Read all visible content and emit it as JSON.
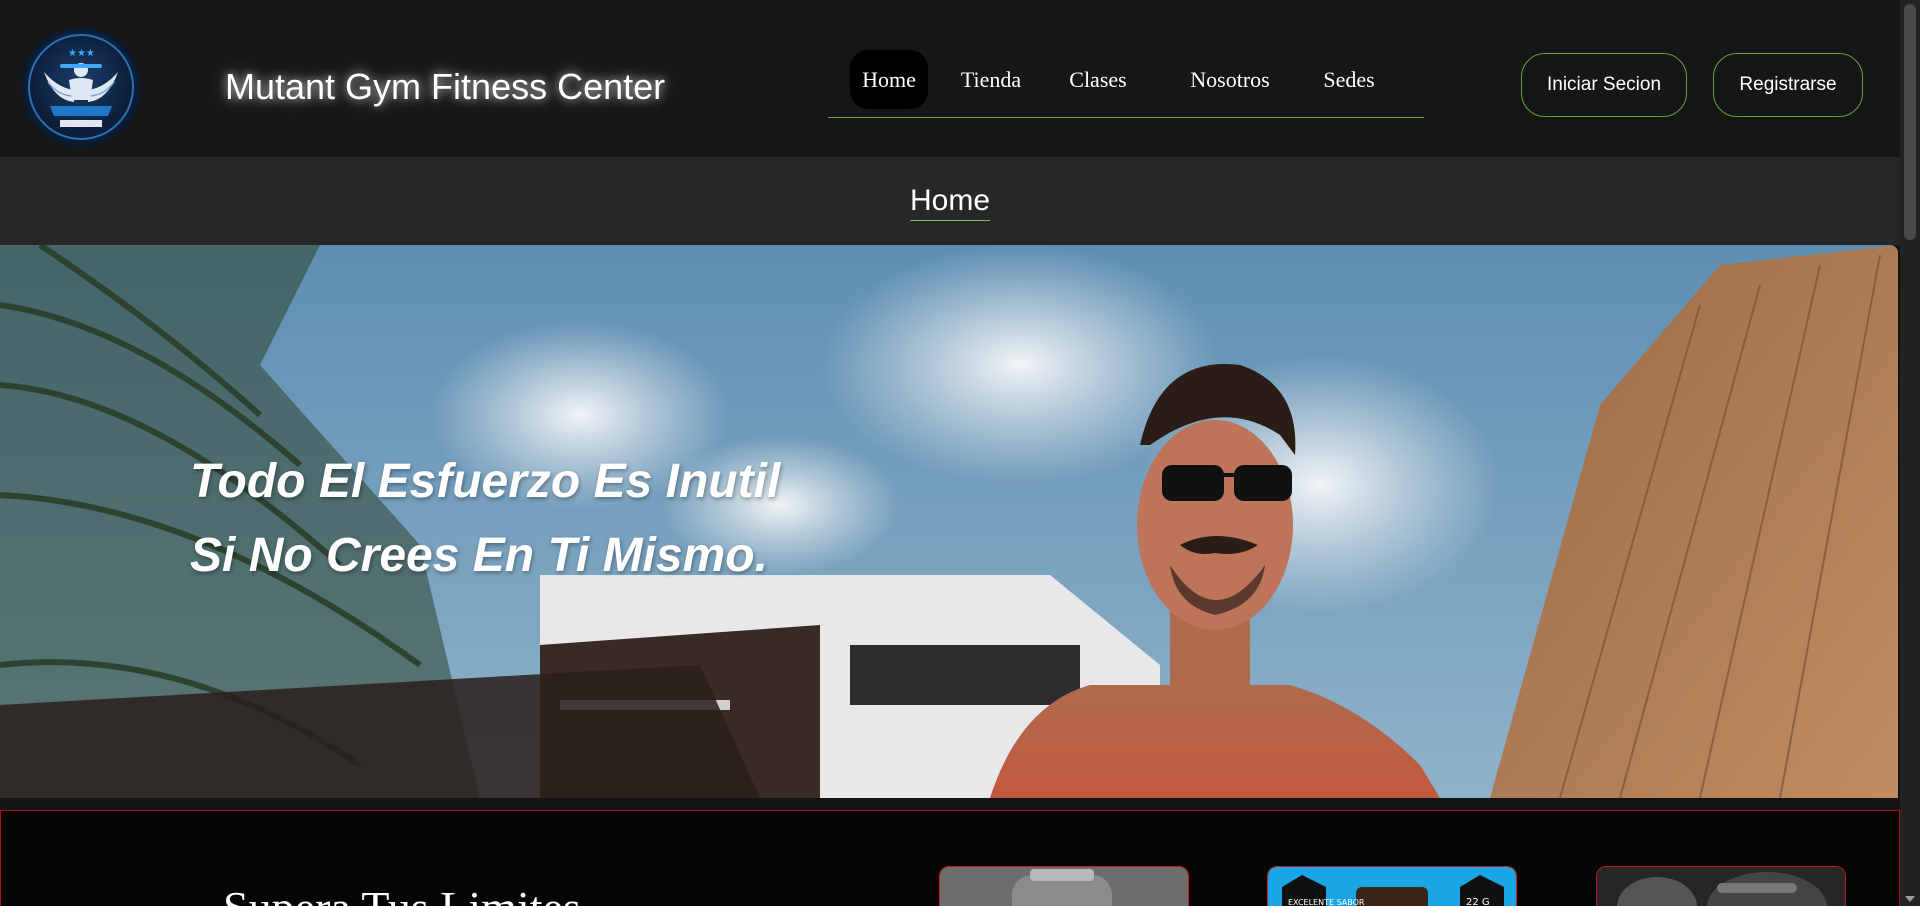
{
  "brand": {
    "name": "Mutant Gym Fitness Center",
    "logo": "gym-crest-logo"
  },
  "nav": {
    "items": [
      {
        "label": "Home",
        "active": true
      },
      {
        "label": "Tienda",
        "active": false
      },
      {
        "label": "Clases",
        "active": false
      },
      {
        "label": "Nosotros",
        "active": false
      },
      {
        "label": "Sedes",
        "active": false
      }
    ]
  },
  "auth": {
    "login_label": "Iniciar Secion",
    "register_label": "Registrarse"
  },
  "section": {
    "title": "Home"
  },
  "hero": {
    "quote_line1": "Todo El Esfuerzo Es Inutil",
    "quote_line2": "Si No Crees En Ti Mismo."
  },
  "promo": {
    "title": "Supera Tus Limites",
    "cards": [
      {
        "name": "supplement-shaker-image"
      },
      {
        "name": "supplement-product-image",
        "badge_left": "EXCELENTE SABOR",
        "badge_right": "22 G"
      },
      {
        "name": "training-photo-image"
      }
    ]
  },
  "colors": {
    "accent_green": "#6aa33a",
    "accent_red": "#b30d0d",
    "header_bg": "#161616"
  }
}
